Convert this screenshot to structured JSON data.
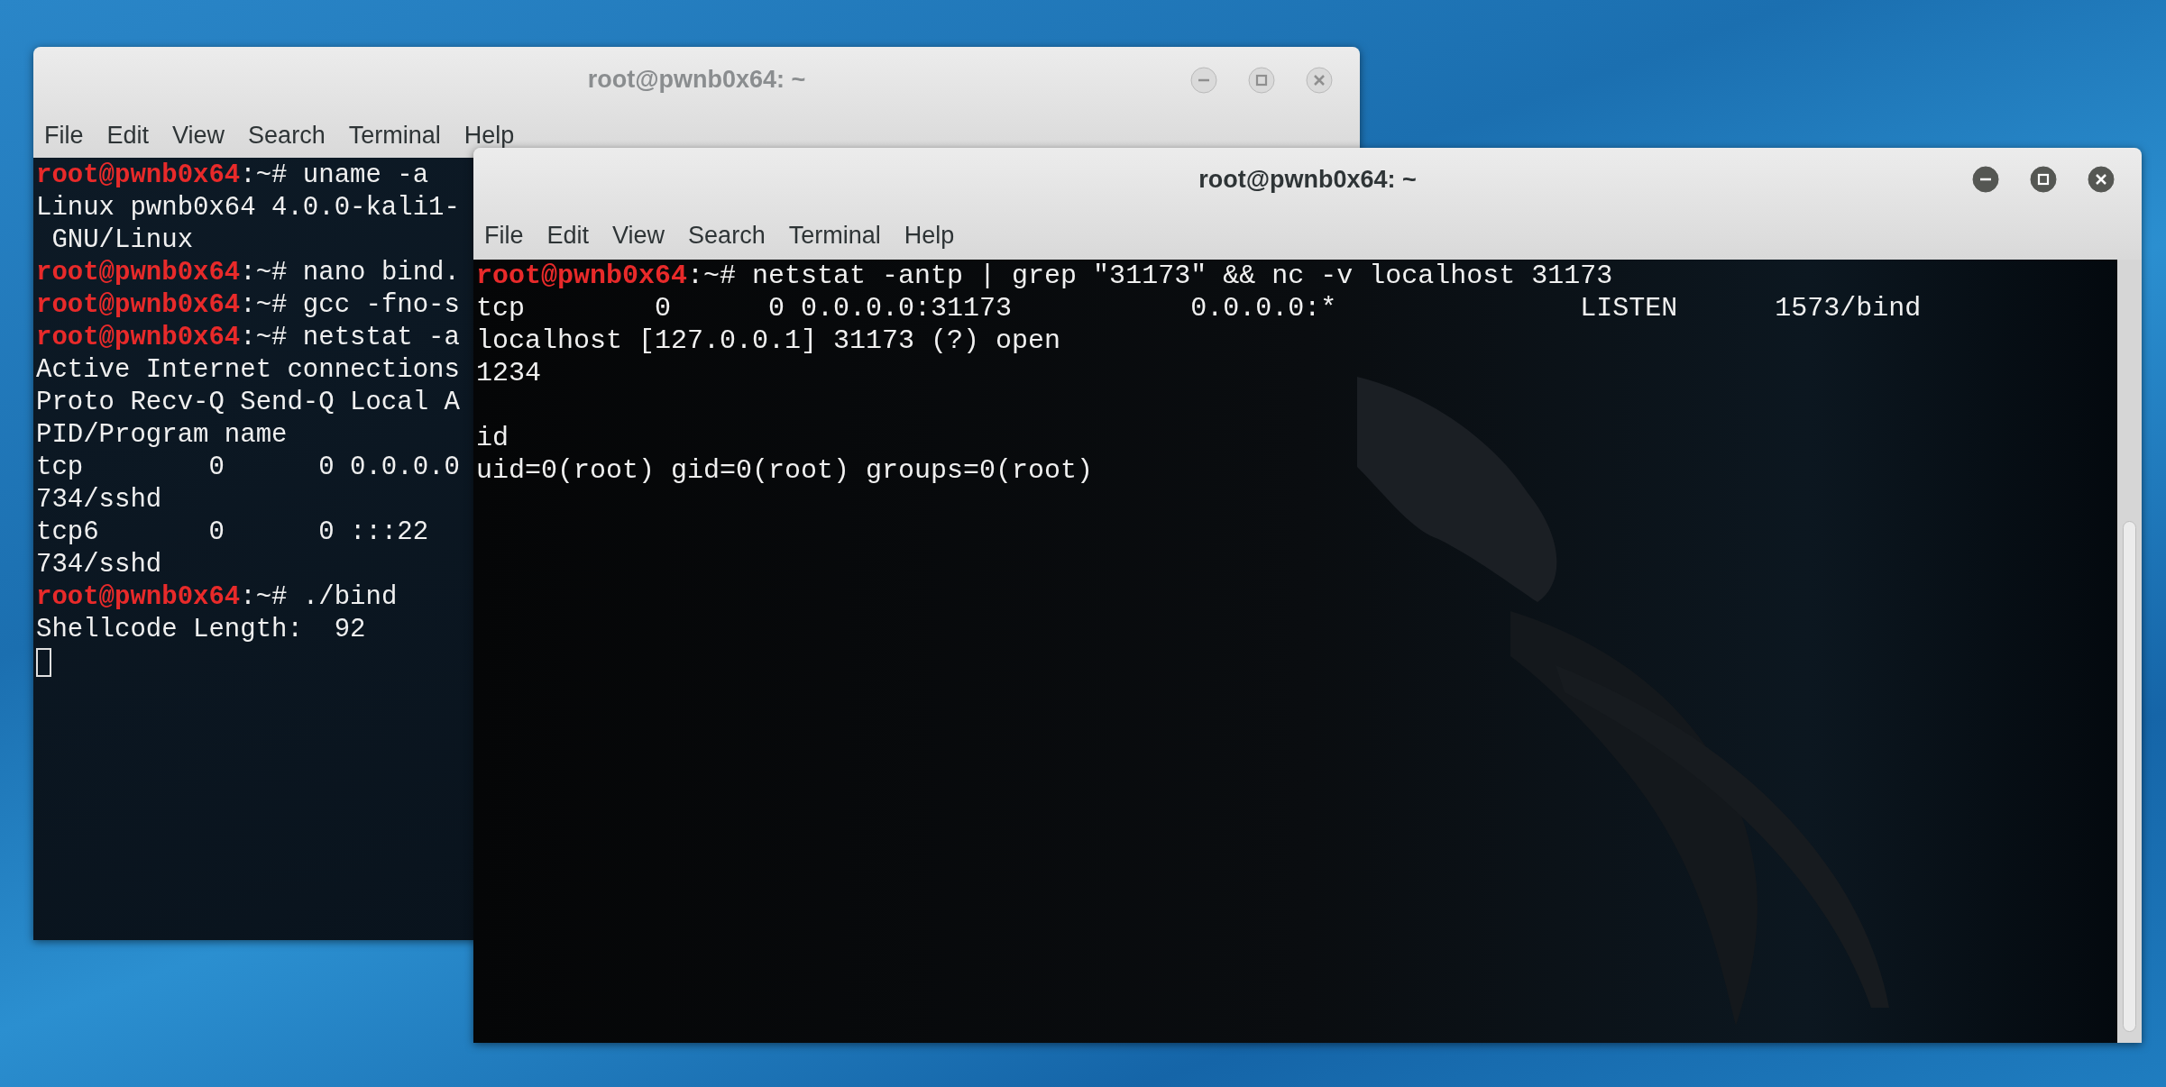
{
  "windows": [
    {
      "title": "root@pwnb0x64: ~",
      "active": false,
      "menu": [
        "File",
        "Edit",
        "View",
        "Search",
        "Terminal",
        "Help"
      ],
      "lines": [
        {
          "kind": "prompt",
          "user": "root@pwnb0x64",
          "text": ":~# uname -a"
        },
        {
          "kind": "output",
          "text": "Linux pwnb0x64 4.0.0-kali1-"
        },
        {
          "kind": "output",
          "text": " GNU/Linux"
        },
        {
          "kind": "prompt",
          "user": "root@pwnb0x64",
          "text": ":~# nano bind."
        },
        {
          "kind": "prompt",
          "user": "root@pwnb0x64",
          "text": ":~# gcc -fno-s"
        },
        {
          "kind": "prompt",
          "user": "root@pwnb0x64",
          "text": ":~# netstat -a"
        },
        {
          "kind": "output",
          "text": "Active Internet connections"
        },
        {
          "kind": "output",
          "text": "Proto Recv-Q Send-Q Local A"
        },
        {
          "kind": "output",
          "text": "PID/Program name"
        },
        {
          "kind": "output",
          "text": "tcp        0      0 0.0.0.0"
        },
        {
          "kind": "output",
          "text": "734/sshd"
        },
        {
          "kind": "output",
          "text": "tcp6       0      0 :::22"
        },
        {
          "kind": "output",
          "text": "734/sshd"
        },
        {
          "kind": "prompt",
          "user": "root@pwnb0x64",
          "text": ":~# ./bind"
        },
        {
          "kind": "output",
          "text": "Shellcode Length:  92"
        },
        {
          "kind": "cursor"
        }
      ]
    },
    {
      "title": "root@pwnb0x64: ~",
      "active": true,
      "menu": [
        "File",
        "Edit",
        "View",
        "Search",
        "Terminal",
        "Help"
      ],
      "lines": [
        {
          "kind": "prompt",
          "user": "root@pwnb0x64",
          "text": ":~# netstat -antp | grep \"31173\" && nc -v localhost 31173"
        },
        {
          "kind": "output",
          "text": "tcp        0      0 0.0.0.0:31173           0.0.0.0:*               LISTEN      1573/bind"
        },
        {
          "kind": "output",
          "text": "localhost [127.0.0.1] 31173 (?) open"
        },
        {
          "kind": "output",
          "text": "1234"
        },
        {
          "kind": "blank"
        },
        {
          "kind": "output",
          "text": "id"
        },
        {
          "kind": "output",
          "text": "uid=0(root) gid=0(root) groups=0(root)"
        }
      ]
    }
  ]
}
